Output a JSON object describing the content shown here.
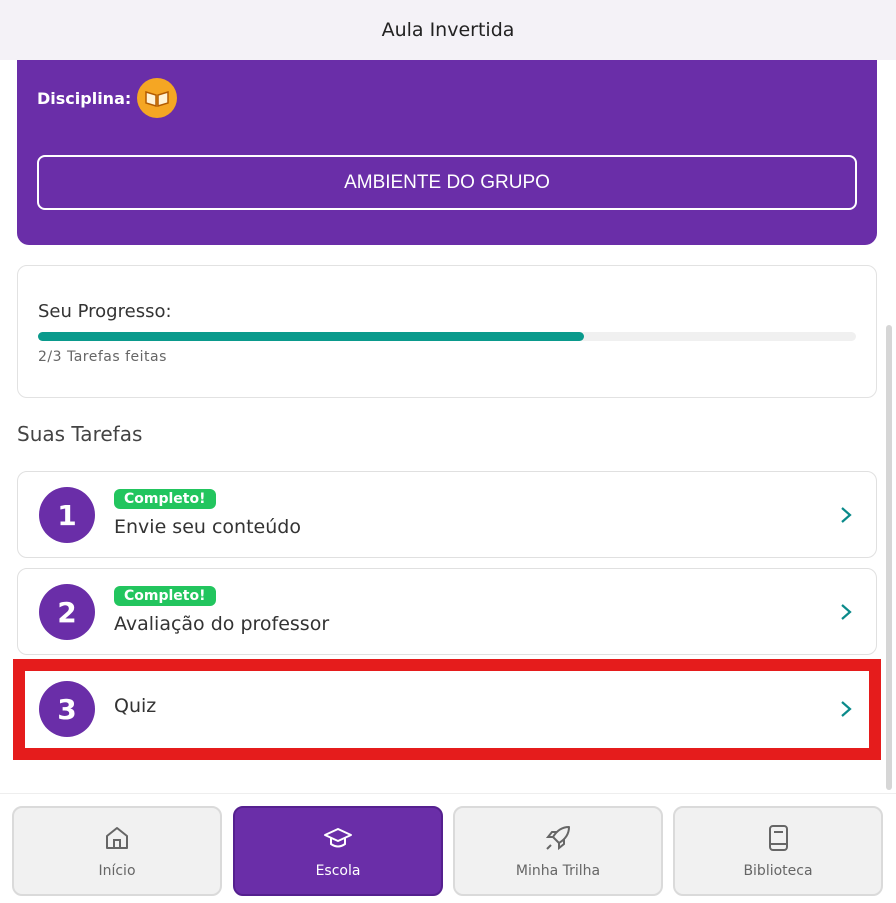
{
  "header": {
    "title": "Aula Invertida"
  },
  "hero": {
    "discipline_label": "Disciplina:",
    "group_button": "AMBIENTE DO GRUPO"
  },
  "progress": {
    "label": "Seu Progresso:",
    "done": 2,
    "total": 3,
    "fraction": 0.667,
    "count_text": "2/3  Tarefas feitas"
  },
  "tasks_section": {
    "title": "Suas Tarefas"
  },
  "tasks": [
    {
      "number": "1",
      "badge": "Completo!",
      "name": "Envie seu conteúdo"
    },
    {
      "number": "2",
      "badge": "Completo!",
      "name": "Avaliação do professor"
    },
    {
      "number": "3",
      "badge": "",
      "name": "Quiz"
    }
  ],
  "bottom_nav": [
    {
      "label": "Início",
      "icon": "home-icon"
    },
    {
      "label": "Escola",
      "icon": "graduation-cap-icon",
      "active": true
    },
    {
      "label": "Minha Trilha",
      "icon": "rocket-icon"
    },
    {
      "label": "Biblioteca",
      "icon": "book-icon"
    }
  ],
  "colors": {
    "primary": "#6a2ea8",
    "progress": "#0a9a8c",
    "badge": "#22c55e",
    "highlight": "#e51c1c",
    "discipline_icon": "#f5a623"
  }
}
